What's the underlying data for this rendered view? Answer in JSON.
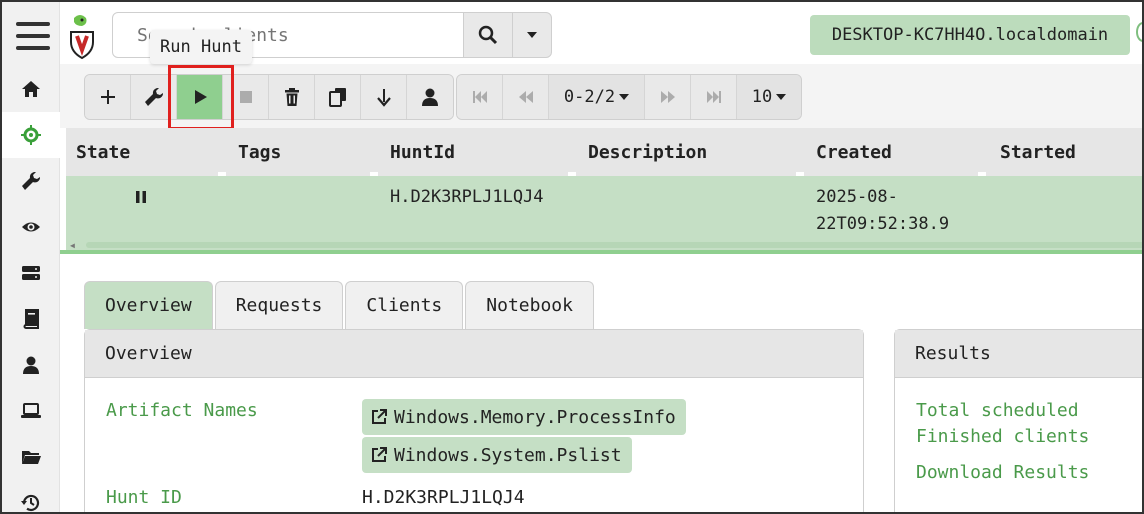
{
  "header": {
    "search_placeholder": "Search clients",
    "hostname": "DESKTOP-KC7HH4O.localdomain",
    "tooltip": "Run Hunt"
  },
  "sidebar": {
    "items": [
      {
        "name": "home",
        "icon": "home-icon"
      },
      {
        "name": "hunt-manager",
        "icon": "crosshair-icon",
        "active": true
      },
      {
        "name": "server-artifacts",
        "icon": "wrench-icon"
      },
      {
        "name": "event-monitoring",
        "icon": "eye-icon"
      },
      {
        "name": "server-events",
        "icon": "server-icon"
      },
      {
        "name": "notebooks",
        "icon": "book-icon"
      },
      {
        "name": "users",
        "icon": "user-icon"
      },
      {
        "name": "clients",
        "icon": "laptop-icon"
      },
      {
        "name": "artifacts",
        "icon": "folder-icon"
      },
      {
        "name": "history",
        "icon": "history-icon"
      }
    ]
  },
  "toolbar": {
    "pager_label": "0-2/2",
    "page_size": "10"
  },
  "table": {
    "headers": [
      "State",
      "Tags",
      "HuntId",
      "Description",
      "Created",
      "Started"
    ],
    "rows": [
      {
        "state": "paused",
        "tags": "",
        "hunt_id": "H.D2K3RPLJ1LQJ4",
        "description": "",
        "created_line1": "2025-08-",
        "created_line2": "22T09:52:38.9",
        "started": ""
      }
    ]
  },
  "tabs": [
    "Overview",
    "Requests",
    "Clients",
    "Notebook"
  ],
  "overview": {
    "title": "Overview",
    "artifact_names_label": "Artifact Names",
    "artifacts": [
      "Windows.Memory.ProcessInfo",
      "Windows.System.Pslist"
    ],
    "hunt_id_label": "Hunt ID",
    "hunt_id_value": "H.D2K3RPLJ1LQJ4"
  },
  "results": {
    "title": "Results",
    "total_scheduled_label": "Total scheduled",
    "finished_clients_label": "Finished clients",
    "download_results_label": "Download Results"
  },
  "colors": {
    "accent_green": "#8fcf8f",
    "row_green": "#c5dfc5",
    "label_green": "#4a9a4a",
    "highlight_red": "#e0201e"
  }
}
